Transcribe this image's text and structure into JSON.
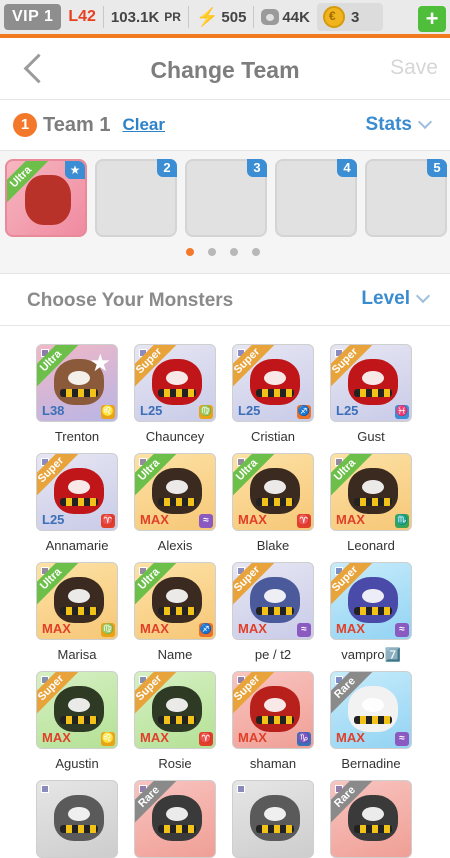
{
  "status": {
    "vip": "VIP 1",
    "level": "L42",
    "power": "103.1K",
    "power_unit": "PR",
    "energy": "505",
    "food": "44K",
    "coins": "3",
    "plus_label": "+"
  },
  "header": {
    "title": "Change Team",
    "save_label": "Save"
  },
  "team": {
    "number": "1",
    "name": "Team 1",
    "clear_label": "Clear",
    "stats_label": "Stats",
    "slots": [
      {
        "num": "",
        "filled": true,
        "rank": "Ultra",
        "bg": "bg-red",
        "color": "#b8322a"
      },
      {
        "num": "2",
        "filled": false
      },
      {
        "num": "3",
        "filled": false
      },
      {
        "num": "4",
        "filled": false
      },
      {
        "num": "5",
        "filled": false
      }
    ],
    "page_dots": 4,
    "active_dot": 0
  },
  "monsters_section": {
    "title": "Choose Your Monsters",
    "sort_label": "Level"
  },
  "monsters": [
    {
      "name": "Trenton",
      "rank": "Ultra",
      "level": "L38",
      "bg": "bg-ultra",
      "ribbon": "#6cc04a",
      "body": "#8a5a3a",
      "sign": "♌",
      "sign_color": "#e8a317",
      "star": true,
      "lv_color": "#3b6fb8"
    },
    {
      "name": "Chauncey",
      "rank": "Super",
      "level": "L25",
      "bg": "bg-super",
      "ribbon": "#e8a33b",
      "body": "#c0161a",
      "sign": "♍",
      "sign_color": "#e8a317",
      "star": false,
      "lv_color": "#3b6fb8"
    },
    {
      "name": "Cristian",
      "rank": "Super",
      "level": "L25",
      "bg": "bg-super",
      "ribbon": "#e8a33b",
      "body": "#c0161a",
      "sign": "♐",
      "sign_color": "#e8722a",
      "star": false,
      "lv_color": "#3b6fb8"
    },
    {
      "name": "Gust",
      "rank": "Super",
      "level": "L25",
      "bg": "bg-super",
      "ribbon": "#e8a33b",
      "body": "#c0161a",
      "sign": "♓",
      "sign_color": "#3b8ed3",
      "star": false,
      "lv_color": "#3b6fb8"
    },
    {
      "name": "Annamarie",
      "rank": "Super",
      "level": "L25",
      "bg": "bg-super",
      "ribbon": "#e8a33b",
      "body": "#c0161a",
      "sign": "♈",
      "sign_color": "#e0402a",
      "star": false,
      "lv_color": "#3b6fb8"
    },
    {
      "name": "Alexis",
      "rank": "Ultra",
      "level": "MAX",
      "bg": "bg-gold",
      "ribbon": "#6cc04a",
      "body": "#3a2a20",
      "sign": "≈",
      "sign_color": "#8a5ac0",
      "star": false,
      "lv_color": "#e0402a"
    },
    {
      "name": "Blake",
      "rank": "Ultra",
      "level": "MAX",
      "bg": "bg-gold",
      "ribbon": "#6cc04a",
      "body": "#3a2a20",
      "sign": "♈",
      "sign_color": "#e0402a",
      "star": false,
      "lv_color": "#e0402a"
    },
    {
      "name": "Leonard",
      "rank": "Ultra",
      "level": "MAX",
      "bg": "bg-gold",
      "ribbon": "#6cc04a",
      "body": "#3a2a20",
      "sign": "♏",
      "sign_color": "#3aa35a",
      "star": false,
      "lv_color": "#e0402a"
    },
    {
      "name": "Marisa",
      "rank": "Ultra",
      "level": "MAX",
      "bg": "bg-gold",
      "ribbon": "#6cc04a",
      "body": "#3a2a20",
      "sign": "♍",
      "sign_color": "#e8a317",
      "star": false,
      "lv_color": "#e0402a"
    },
    {
      "name": "Name",
      "rank": "Ultra",
      "level": "MAX",
      "bg": "bg-gold",
      "ribbon": "#6cc04a",
      "body": "#3a2a20",
      "sign": "♐",
      "sign_color": "#e8722a",
      "star": false,
      "lv_color": "#e0402a"
    },
    {
      "name": "pe / t2",
      "rank": "Super",
      "level": "MAX",
      "bg": "bg-super",
      "ribbon": "#e8a33b",
      "body": "#4a5a9a",
      "sign": "≈",
      "sign_color": "#8a5ac0",
      "star": false,
      "lv_color": "#e0402a"
    },
    {
      "name": "vampro7️⃣",
      "rank": "Super",
      "level": "MAX",
      "bg": "bg-blue",
      "ribbon": "#e8a33b",
      "body": "#4a4aa8",
      "sign": "≈",
      "sign_color": "#8a5ac0",
      "star": false,
      "lv_color": "#e0402a"
    },
    {
      "name": "Agustin",
      "rank": "Super",
      "level": "MAX",
      "bg": "bg-green",
      "ribbon": "#e8a33b",
      "body": "#2e3a24",
      "sign": "♌",
      "sign_color": "#e8a317",
      "star": false,
      "lv_color": "#e0402a"
    },
    {
      "name": "Rosie",
      "rank": "Super",
      "level": "MAX",
      "bg": "bg-green",
      "ribbon": "#e8a33b",
      "body": "#2e3a24",
      "sign": "♈",
      "sign_color": "#e0402a",
      "star": false,
      "lv_color": "#e0402a"
    },
    {
      "name": "shaman",
      "rank": "Super",
      "level": "MAX",
      "bg": "bg-red",
      "ribbon": "#e8a33b",
      "body": "#b8201c",
      "sign": "♑",
      "sign_color": "#3b6fb8",
      "star": false,
      "lv_color": "#e0402a"
    },
    {
      "name": "Bernadine",
      "rank": "Rare",
      "level": "MAX",
      "bg": "bg-blue",
      "ribbon": "#8a8a8a",
      "body": "#f2f2f2",
      "sign": "≈",
      "sign_color": "#8a5ac0",
      "star": false,
      "lv_color": "#e0402a"
    },
    {
      "name": "",
      "rank": "",
      "level": "",
      "bg": "bg-gray",
      "ribbon": "",
      "body": "#5a5a5a",
      "sign": "",
      "sign_color": "",
      "star": false,
      "lv_color": "#e0402a"
    },
    {
      "name": "",
      "rank": "Rare",
      "level": "",
      "bg": "bg-red",
      "ribbon": "#8a8a8a",
      "body": "#3a3a3a",
      "sign": "",
      "sign_color": "",
      "star": false,
      "lv_color": "#e0402a"
    },
    {
      "name": "",
      "rank": "",
      "level": "",
      "bg": "bg-gray",
      "ribbon": "",
      "body": "#5a5a5a",
      "sign": "",
      "sign_color": "",
      "star": false,
      "lv_color": "#e0402a"
    },
    {
      "name": "",
      "rank": "Rare",
      "level": "",
      "bg": "bg-red",
      "ribbon": "#8a8a8a",
      "body": "#3a3a3a",
      "sign": "",
      "sign_color": "",
      "star": false,
      "lv_color": "#e0402a"
    }
  ]
}
